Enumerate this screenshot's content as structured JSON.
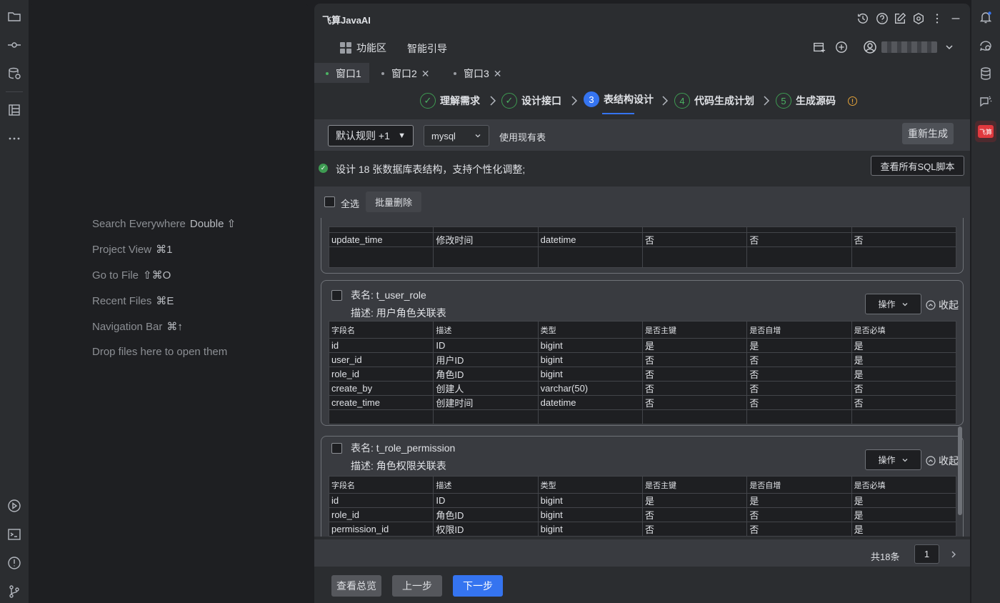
{
  "editor_hints": [
    {
      "label": "Search Everywhere",
      "shortcut": "Double ⇧"
    },
    {
      "label": "Project View",
      "shortcut": "⌘1"
    },
    {
      "label": "Go to File",
      "shortcut": "⇧⌘O"
    },
    {
      "label": "Recent Files",
      "shortcut": "⌘E"
    },
    {
      "label": "Navigation Bar",
      "shortcut": "⌘↑"
    },
    {
      "label": "Drop files here to open them",
      "shortcut": ""
    }
  ],
  "panel": {
    "title": "飞算JavaAI",
    "nav": {
      "features": "功能区",
      "guide": "智能引导"
    },
    "tabs": [
      {
        "label": "窗口1",
        "active": true,
        "closable": false
      },
      {
        "label": "窗口2",
        "active": false,
        "closable": true
      },
      {
        "label": "窗口3",
        "active": false,
        "closable": true
      }
    ],
    "steps": [
      {
        "label": "理解需求",
        "state": "done"
      },
      {
        "label": "设计接口",
        "state": "done"
      },
      {
        "num": "3",
        "label": "表结构设计",
        "state": "active"
      },
      {
        "num": "4",
        "label": "代码生成计划",
        "state": "todo"
      },
      {
        "num": "5",
        "label": "生成源码",
        "state": "todo"
      }
    ],
    "toolbar": {
      "rule_select": "默认规则 +1",
      "db_select": "mysql",
      "use_existing": "使用现有表",
      "regenerate": "重新生成"
    },
    "info": {
      "message": "设计 18 张数据库表结构，支持个性化调整;",
      "view_sql": "查看所有SQL脚本"
    },
    "selection": {
      "select_all": "全选",
      "batch_delete": "批量删除"
    },
    "columns": [
      "字段名",
      "描述",
      "类型",
      "是否主键",
      "是否自增",
      "是否必填"
    ],
    "partial_row": [
      "update_time",
      "修改时间",
      "datetime",
      "否",
      "否",
      "否"
    ],
    "tables": [
      {
        "name": "表名: t_user_role",
        "desc": "描述: 用户角色关联表",
        "op": "操作",
        "collapse": "收起",
        "rows": [
          [
            "id",
            "ID",
            "bigint",
            "是",
            "是",
            "是"
          ],
          [
            "user_id",
            "用户ID",
            "bigint",
            "否",
            "否",
            "是"
          ],
          [
            "role_id",
            "角色ID",
            "bigint",
            "否",
            "否",
            "是"
          ],
          [
            "create_by",
            "创建人",
            "varchar(50)",
            "否",
            "否",
            "否"
          ],
          [
            "create_time",
            "创建时间",
            "datetime",
            "否",
            "否",
            "否"
          ]
        ]
      },
      {
        "name": "表名: t_role_permission",
        "desc": "描述: 角色权限关联表",
        "op": "操作",
        "collapse": "收起",
        "rows": [
          [
            "id",
            "ID",
            "bigint",
            "是",
            "是",
            "是"
          ],
          [
            "role_id",
            "角色ID",
            "bigint",
            "否",
            "否",
            "是"
          ],
          [
            "permission_id",
            "权限ID",
            "bigint",
            "否",
            "否",
            "是"
          ]
        ]
      }
    ],
    "pager": {
      "total": "共18条",
      "page": "1"
    },
    "footer": {
      "overview": "查看总览",
      "prev": "上一步",
      "next": "下一步"
    },
    "colors": {
      "accent": "#3574f0",
      "success": "#3e9b52",
      "warning": "#e5a33a"
    }
  }
}
